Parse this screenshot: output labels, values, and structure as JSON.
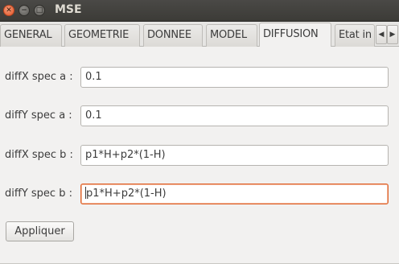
{
  "window": {
    "title": "MSE",
    "close_glyph": "✕",
    "min_glyph": "−",
    "max_glyph": "□"
  },
  "tabs": [
    {
      "label": "GENERAL"
    },
    {
      "label": "GEOMETRIE"
    },
    {
      "label": "DONNEE"
    },
    {
      "label": "MODEL"
    },
    {
      "label": "DIFFUSION"
    },
    {
      "label": "Etat in"
    }
  ],
  "active_tab": "DIFFUSION",
  "tab_scroll": {
    "left_glyph": "◀",
    "right_glyph": "▶"
  },
  "form": {
    "rows": [
      {
        "label": "diffX spec a :",
        "value": "0.1"
      },
      {
        "label": "diffY spec a :",
        "value": "0.1"
      },
      {
        "label": "diffX spec b :",
        "value": "p1*H+p2*(1-H)"
      },
      {
        "label": "diffY spec b :",
        "value": "p1*H+p2*(1-H)"
      }
    ],
    "apply_label": "Appliquer"
  },
  "colors": {
    "focus_border": "#e0652d",
    "titlebar": "#3c3b37",
    "close_button": "#e2582a"
  },
  "icons": {
    "close": "close-icon",
    "minimize": "minimize-icon",
    "maximize": "maximize-icon",
    "scroll_left": "chevron-left-icon",
    "scroll_right": "chevron-right-icon"
  }
}
